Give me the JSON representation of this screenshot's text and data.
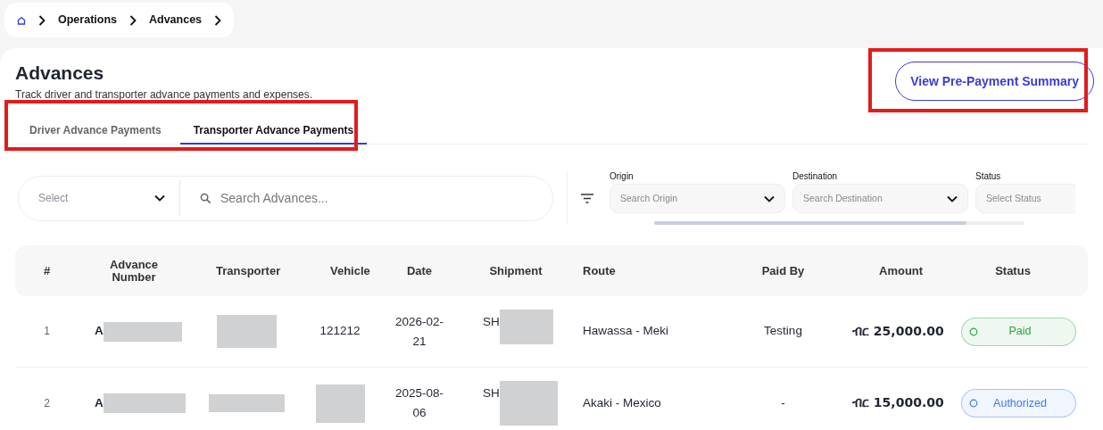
{
  "breadcrumb": {
    "items": [
      "Operations",
      "Advances"
    ]
  },
  "header": {
    "title": "Advances",
    "subtitle": "Track driver and transporter advance payments and expenses.",
    "action": "View Pre-Payment Summary"
  },
  "tabs": [
    {
      "label": "Driver Advance Payments",
      "selected": false
    },
    {
      "label": "Transporter Advance Payments",
      "selected": true
    }
  ],
  "filters": {
    "type_select": {
      "placeholder": "Select"
    },
    "search": {
      "placeholder": "Search Advances..."
    },
    "dropdowns": [
      {
        "label": "Origin",
        "placeholder": "Search Origin",
        "kind": "dropdown"
      },
      {
        "label": "Destination",
        "placeholder": "Search Destination",
        "kind": "dropdown"
      },
      {
        "label": "Status",
        "placeholder": "Select Status",
        "kind": "select"
      }
    ]
  },
  "table": {
    "columns": [
      "#",
      "Advance Number",
      "Transporter",
      "Vehicle",
      "Date",
      "Shipment",
      "Route",
      "Paid By",
      "Amount",
      "Status"
    ],
    "rows": [
      {
        "index": "1",
        "advance_number": "A",
        "vehicle": "121212",
        "date": "2026-02-21",
        "shipment": "SH",
        "route": "Hawassa - Meki",
        "paid_by": "Testing",
        "amount": "ብር 25,000.00",
        "status": "Paid",
        "color": "#22a83a"
      },
      {
        "index": "2",
        "advance_number": "A",
        "date": "2025-08-06",
        "shipment": "SH",
        "route": "Akaki - Mexico",
        "paid_by": "-",
        "amount": "ብር 15,000.00",
        "status": "Authorized",
        "color": "#3d7cf0"
      }
    ]
  }
}
